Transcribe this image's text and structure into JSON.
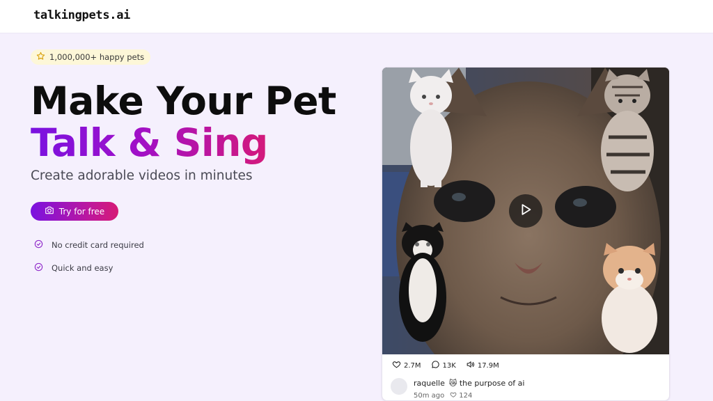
{
  "header": {
    "logo_text": "talkingpets.ai"
  },
  "hero": {
    "badge_icon": "star-icon",
    "badge_text": "1,000,000+ happy pets",
    "title_line1": "Make Your Pet",
    "title_line2": "Talk & Sing",
    "subtitle": "Create adorable videos in minutes",
    "cta_icon": "camera-icon",
    "cta_label": "Try for free",
    "features": [
      {
        "icon": "check-circle-icon",
        "text": "No credit card required"
      },
      {
        "icon": "check-circle-icon",
        "text": "Quick and easy"
      }
    ]
  },
  "video_card": {
    "play_icon": "play-icon",
    "stats": {
      "likes": "2.7M",
      "comments": "13K",
      "views": "17.9M"
    },
    "comment": {
      "username": "raquelle",
      "emoji": "😿",
      "text": "the purpose of ai",
      "time": "50m ago",
      "likes": "124"
    }
  },
  "colors": {
    "accent_purple": "#7a12e0",
    "accent_pink": "#d61a75",
    "page_bg": "#f5f0fd",
    "badge_bg": "#fdf7d8"
  }
}
